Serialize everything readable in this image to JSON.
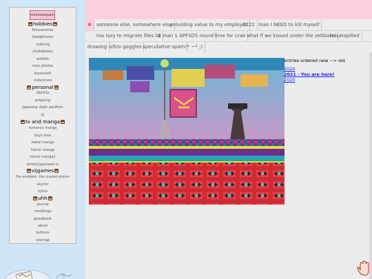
{
  "sidebar": {
    "title": "incessantpain",
    "sections": [
      {
        "heading": "hobbies",
        "links": [
          "filmcameras",
          "headphones",
          "clothing",
          "photobooks",
          "wildlife",
          "misc.photos",
          "bookshelf",
          "collections"
        ]
      },
      {
        "heading": "personal",
        "links": [
          "identity",
          "prepping",
          "japanese state pacifism",
          "jjj"
        ]
      },
      {
        "heading": "tv and manga",
        "links": [
          "romance manga",
          "boys love",
          "isekai manga",
          "horror manga",
          "horror manga2",
          "british/japanese tv"
        ]
      },
      {
        "heading": "vijgames",
        "links": [
          "fire emblem: the scared stones",
          "skyrim",
          "hylics"
        ]
      },
      {
        "heading": "uhh",
        "links": [
          "journal",
          "ramblings",
          "guestbook",
          "about",
          "buttons",
          "sitemap"
        ]
      }
    ]
  },
  "tags": {
    "home_icon": "✱",
    "row1": [
      "someone else, somewhere else",
      "providing value to my employer",
      "2222",
      "man I NEED to kill myself"
    ],
    "row2": [
      "too lazy to migrate files lol",
      "1 man 1 APFSDS round",
      "time for crab",
      "what if we kissed under the zeltbahn",
      "misatopilled"
    ],
    "row3": [
      "drawing",
      "a/b/o goggles",
      "speculative spam",
      "(* ~* ;)"
    ]
  },
  "main": {
    "entries_heading": "entries ordered new ~> old",
    "entries": [
      "2024",
      "2021 - You are here!",
      "2020"
    ]
  },
  "colors": {
    "accent_pink": "#fbd0dc",
    "link_blue": "#1a1aee",
    "panel": "#ececec",
    "bg": "#cfe6f8"
  }
}
